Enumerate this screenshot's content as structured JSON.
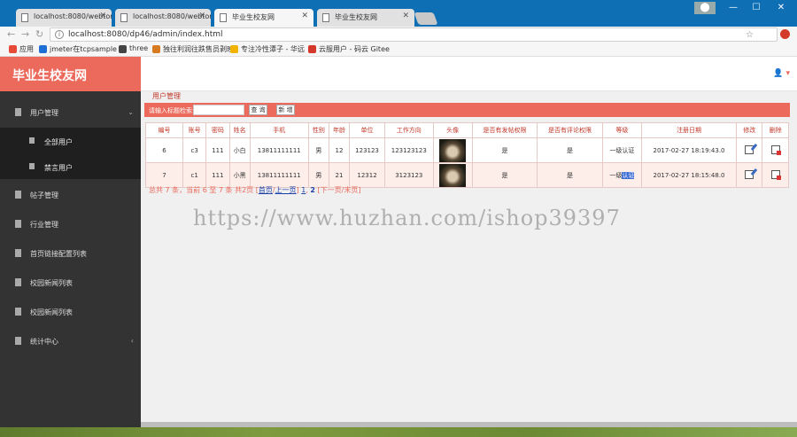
{
  "browser": {
    "tabs": [
      {
        "title": "localhost:8080/webtor",
        "active": false
      },
      {
        "title": "localhost:8080/webtor",
        "active": false
      },
      {
        "title": "毕业生校友网",
        "active": true
      },
      {
        "title": "毕业生校友网",
        "active": false
      }
    ],
    "url": "localhost:8080/dp46/admin/index.html",
    "bookmarks": [
      "应用",
      "jmeter在tcpsample",
      "three",
      "独往利润往跌售员剥映",
      "专注冷性潭子 - 华远",
      "云服用户 - 码云 Gitee"
    ],
    "bookmark_colors": [
      "#e84a3a",
      "#1e6fd6",
      "#444444",
      "#d87a1f",
      "#f1b300",
      "#d3382a"
    ]
  },
  "app": {
    "brand": "毕业生校友网",
    "brand_color": "#ec6a5b",
    "user_icon": "user-icon"
  },
  "sidebar": {
    "items": [
      {
        "label": "用户管理",
        "expanded": true
      },
      {
        "label": "全部用户",
        "sub": true
      },
      {
        "label": "禁言用户",
        "sub": true
      },
      {
        "label": "帖子管理"
      },
      {
        "label": "行业管理"
      },
      {
        "label": "首页链接配置列表"
      },
      {
        "label": "校园新闻列表"
      },
      {
        "label": "校园新闻列表"
      },
      {
        "label": "统计中心"
      }
    ]
  },
  "main": {
    "page_title": "用户管理",
    "search": {
      "label": "请输入标题检索:",
      "value": "",
      "query_button": "查 询",
      "add_button": "新 增"
    },
    "table": {
      "headers": [
        "编号",
        "账号",
        "密码",
        "姓名",
        "手机",
        "性别",
        "年龄",
        "单位",
        "工作方向",
        "头像",
        "是否有发帖权限",
        "是否有评论权限",
        "等级",
        "注册日期",
        "修改",
        "删除"
      ],
      "rows": [
        [
          "6",
          "c3",
          "111",
          "小白",
          "13811111111",
          "男",
          "12",
          "123123",
          "123123123",
          "",
          "是",
          "是",
          "一级认证",
          "2017-02-27 18:19:43.0",
          "",
          ""
        ],
        [
          "7",
          "c1",
          "111",
          "小黑",
          "13811111111",
          "男",
          "21",
          "12312",
          "3123123",
          "",
          "是",
          "是",
          "一级认证",
          "2017-02-27 18:15:48.0",
          "",
          ""
        ]
      ],
      "row_highlight_color": "#fdeee9"
    },
    "pager": {
      "summary": "总共 7 条，当前 6 至 7 条 共2页",
      "first": "首页",
      "prev": "上一页",
      "page1": "1",
      "page2": "2",
      "next": "下一页",
      "last": "末页"
    }
  },
  "watermark": "https://www.huzhan.com/ishop39397"
}
